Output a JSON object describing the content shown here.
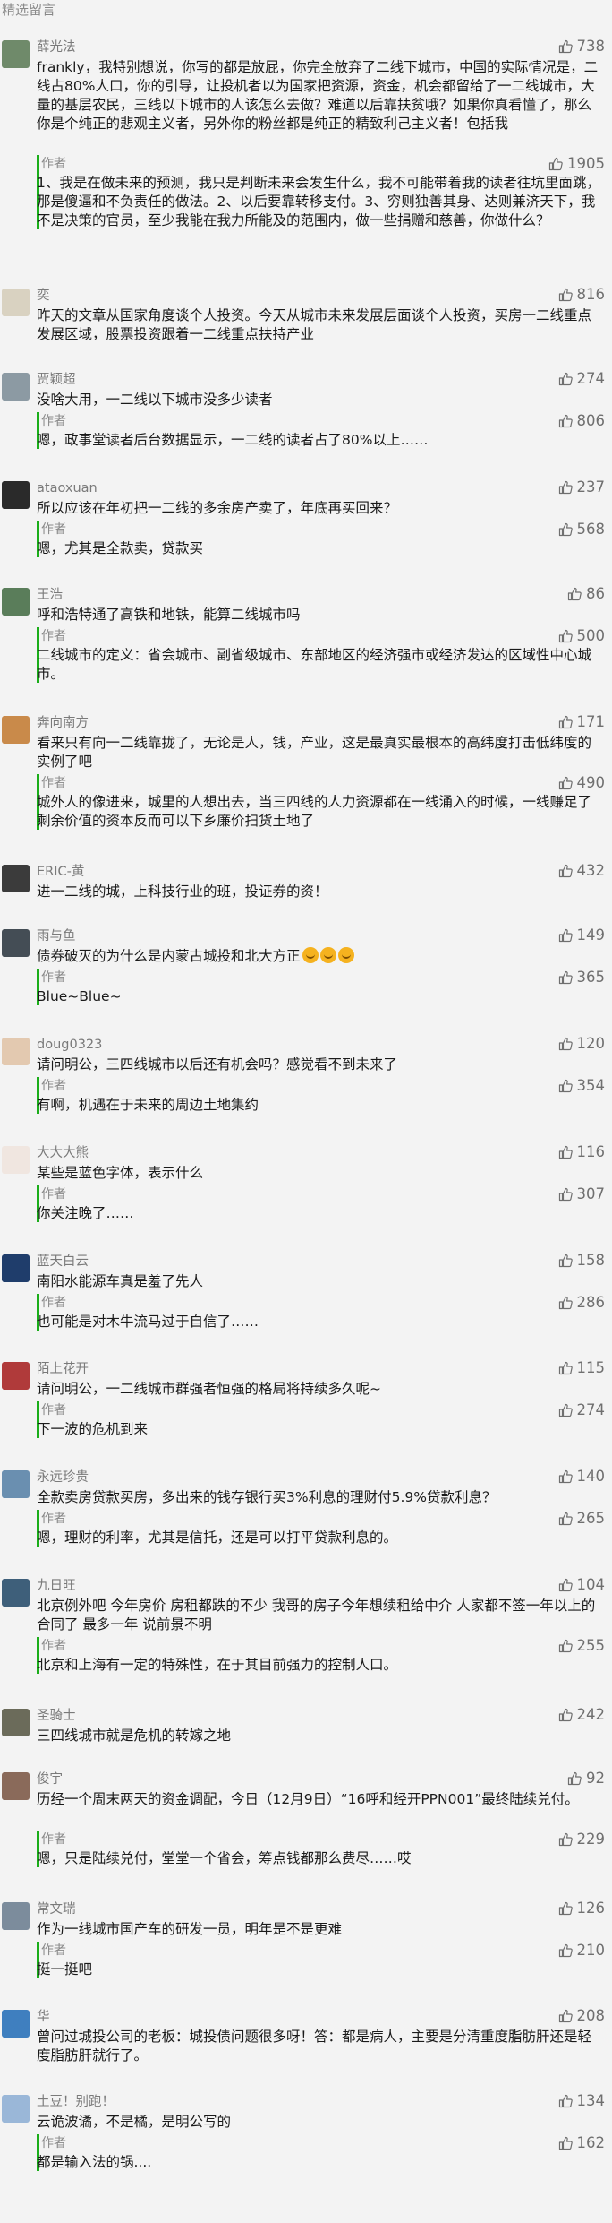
{
  "section_title": "精选留言",
  "author_label": "作者",
  "comments": [
    {
      "user": "薛光法",
      "likes": "738",
      "text": "frankly，我特别想说，你写的都是放屁，你完全放弃了二线下城市，中国的实际情况是，二线占80%人口，你的引导，让投机者以为国家把资源，资金，机会都留给了一二线城市，大量的基层农民，三线以下城市的人该怎么去做？难道以后靠扶贫哦？如果你真看懂了，那么你是个纯正的悲观主义者，另外你的粉丝都是纯正的精致利己主义者！包括我",
      "reply_likes": "1905",
      "reply": "1、我是在做未来的预测，我只是判断未来会发生什么，我不可能带着我的读者往坑里面跳，那是傻逼和不负责任的做法。2、以后要靠转移支付。3、穷则独善其身、达则兼济天下，我不是决策的官员，至少我能在我力所能及的范围内，做一些捐赠和慈善，你做什么？",
      "avatar_color": "#6f8a6a"
    },
    {
      "user": "奕",
      "likes": "816",
      "text": "昨天的文章从国家角度谈个人投资。今天从城市未来发展层面谈个人投资，买房一二线重点发展区域，股票投资跟着一二线重点扶持产业",
      "reply_likes": "",
      "reply": "",
      "avatar_color": "#d9d2c1"
    },
    {
      "user": "贾颖超",
      "likes": "274",
      "text": "没啥大用，一二线以下城市没多少读者",
      "reply_likes": "806",
      "reply": "嗯，政事堂读者后台数据显示，一二线的读者占了80%以上……",
      "avatar_color": "#8c9aa3"
    },
    {
      "user": "ataoxuan",
      "likes": "237",
      "text": "所以应该在年初把一二线的多余房产卖了，年底再买回来？",
      "reply_likes": "568",
      "reply": "嗯，尤其是全款卖，贷款买",
      "avatar_color": "#2a2a2a"
    },
    {
      "user": "王浩",
      "likes": "86",
      "text": "呼和浩特通了高铁和地铁，能算二线城市吗",
      "reply_likes": "500",
      "reply": "二线城市的定义：省会城市、副省级城市、东部地区的经济强市或经济发达的区域性中心城市。",
      "avatar_color": "#5a7d5a"
    },
    {
      "user": "奔向南方",
      "likes": "171",
      "text": "看来只有向一二线靠拢了，无论是人，钱，产业，这是最真实最根本的高纬度打击低纬度的实例了吧",
      "reply_likes": "490",
      "reply": "城外人的像进来，城里的人想出去，当三四线的人力资源都在一线涌入的时候，一线赚足了剩余价值的资本反而可以下乡廉价扫货土地了",
      "avatar_color": "#c98a4a"
    },
    {
      "user": "ERIC-黄",
      "likes": "432",
      "text": "进一二线的城，上科技行业的班，投证券的资！",
      "reply_likes": "",
      "reply": "",
      "avatar_color": "#3b3b3b"
    },
    {
      "user": "雨与鱼",
      "likes": "149",
      "text": "债券破灭的为什么是内蒙古城投和北大方正",
      "reply_likes": "365",
      "reply": "Blue~Blue~",
      "avatar_color": "#444d55"
    },
    {
      "user": "doug0323",
      "likes": "120",
      "text": "请问明公，三四线城市以后还有机会吗？感觉看不到未来了",
      "reply_likes": "354",
      "reply": "有啊，机遇在于未来的周边土地集约",
      "avatar_color": "#e3c9b0"
    },
    {
      "user": "大大大熊",
      "likes": "116",
      "text": "某些是蓝色字体，表示什么",
      "reply_likes": "307",
      "reply": "你关注晚了……",
      "avatar_color": "#f0e6e0"
    },
    {
      "user": "蓝天白云",
      "likes": "158",
      "text": "南阳水能源车真是羞了先人",
      "reply_likes": "286",
      "reply": "也可能是对木牛流马过于自信了……",
      "avatar_color": "#1f3d6b"
    },
    {
      "user": "陌上花开",
      "likes": "115",
      "text": "请问明公，一二线城市群强者恒强的格局将持续多久呢~",
      "reply_likes": "274",
      "reply": "下一波的危机到来",
      "avatar_color": "#b03a3a"
    },
    {
      "user": "永远珍贵",
      "likes": "140",
      "text": "全款卖房贷款买房，多出来的钱存银行买3%利息的理财付5.9%贷款利息？",
      "reply_likes": "265",
      "reply": "嗯，理财的利率，尤其是信托，还是可以打平贷款利息的。",
      "avatar_color": "#6a8fb0"
    },
    {
      "user": "九日旺",
      "likes": "104",
      "text": "北京例外吧 今年房价 房租都跌的不少 我哥的房子今年想续租给中介 人家都不签一年以上的合同了 最多一年 说前景不明",
      "reply_likes": "255",
      "reply": "北京和上海有一定的特殊性，在于其目前强力的控制人口。",
      "avatar_color": "#3e5f7a"
    },
    {
      "user": "圣骑士",
      "likes": "242",
      "text": "三四线城市就是危机的转嫁之地",
      "reply_likes": "",
      "reply": "",
      "avatar_color": "#6b6b5a"
    },
    {
      "user": "俊宇",
      "likes": "92",
      "text": "历经一个周末两天的资金调配，今日（12月9日）“16呼和经开PPN001”最终陆续兑付。",
      "reply_likes": "229",
      "reply": "嗯，只是陆续兑付，堂堂一个省会，筹点钱都那么费尽……哎",
      "avatar_color": "#8a6a5a"
    },
    {
      "user": "常文瑞",
      "likes": "126",
      "text": "作为一线城市国产车的研发一员，明年是不是更难",
      "reply_likes": "210",
      "reply": "挺一挺吧",
      "avatar_color": "#7c8c9c"
    },
    {
      "user": "华",
      "likes": "208",
      "text": "曾问过城投公司的老板：城投债问题很多呀！答：都是病人，主要是分清重度脂肪肝还是轻度脂肪肝就行了。",
      "reply_likes": "",
      "reply": "",
      "avatar_color": "#3f7fbf"
    },
    {
      "user": "土豆！别跑！",
      "likes": "134",
      "text": "云诡波谲，不是橘，是明公写的",
      "reply_likes": "162",
      "reply": "都是输入法的锅....",
      "avatar_color": "#9ab7d8"
    }
  ],
  "accent_color": "#1aad19"
}
